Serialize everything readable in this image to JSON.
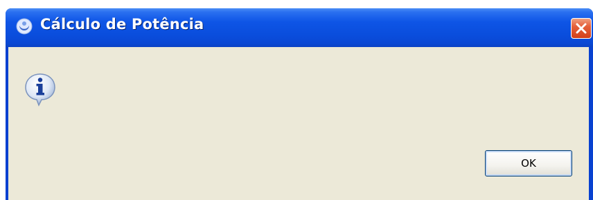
{
  "window": {
    "title": "Cálculo de Potência",
    "app_icon": "java-app-icon",
    "close_icon": "close-icon"
  },
  "dialog": {
    "icon": "info-icon",
    "message": "",
    "ok_label": "OK"
  },
  "colors": {
    "titlebar": "#0a4ddc",
    "client_bg": "#ece9d8",
    "close_button": "#d2401a",
    "button_border": "#003c74"
  }
}
